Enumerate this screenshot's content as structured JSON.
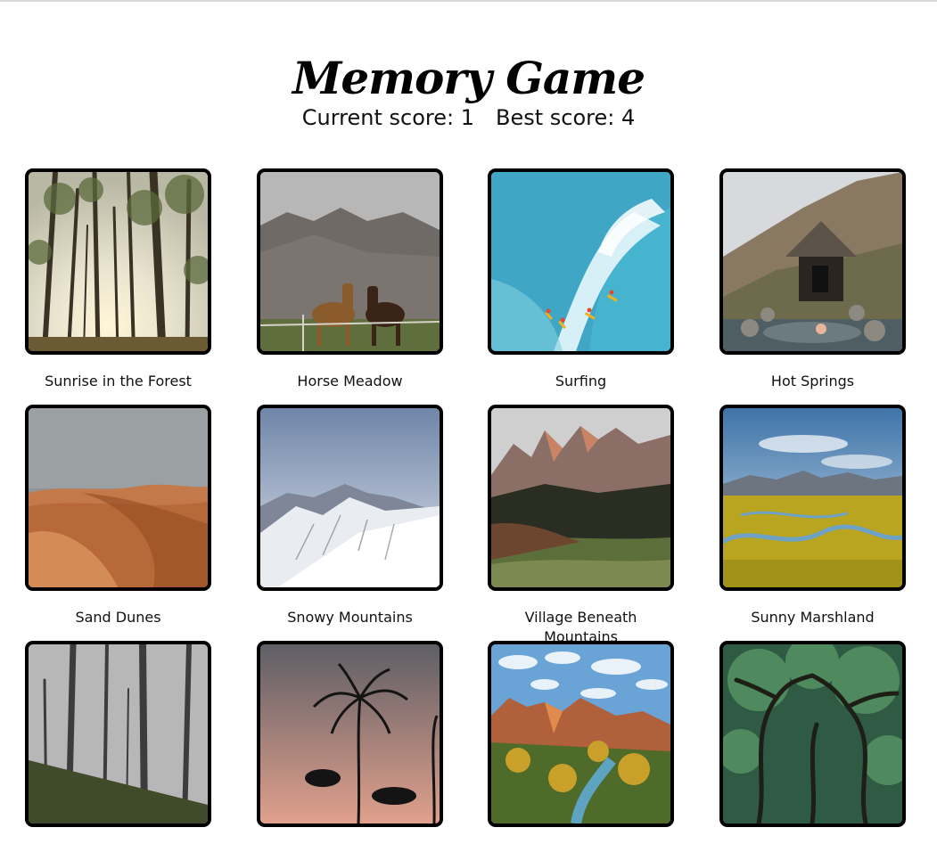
{
  "header": {
    "title": "Memory Game",
    "current_score_label": "Current score: 1",
    "best_score_label": "Best score: 4"
  },
  "cards": [
    {
      "label": "Sunrise in the Forest",
      "icon": "forest-sunrise-image"
    },
    {
      "label": "Horse Meadow",
      "icon": "horse-meadow-image"
    },
    {
      "label": "Surfing",
      "icon": "surfing-image"
    },
    {
      "label": "Hot Springs",
      "icon": "hot-springs-image"
    },
    {
      "label": "Sand Dunes",
      "icon": "sand-dunes-image"
    },
    {
      "label": "Snowy Mountains",
      "icon": "snowy-mountains-image"
    },
    {
      "label": "Village Beneath Mountains",
      "icon": "village-mountains-image"
    },
    {
      "label": "Sunny Marshland",
      "icon": "marshland-image"
    },
    {
      "label": "",
      "icon": "misty-forest-image"
    },
    {
      "label": "",
      "icon": "palm-sunset-image"
    },
    {
      "label": "",
      "icon": "canyon-river-image"
    },
    {
      "label": "",
      "icon": "tree-canopy-image"
    }
  ],
  "colors": {
    "card_border": "#000000",
    "text": "#111111",
    "background": "#ffffff"
  }
}
